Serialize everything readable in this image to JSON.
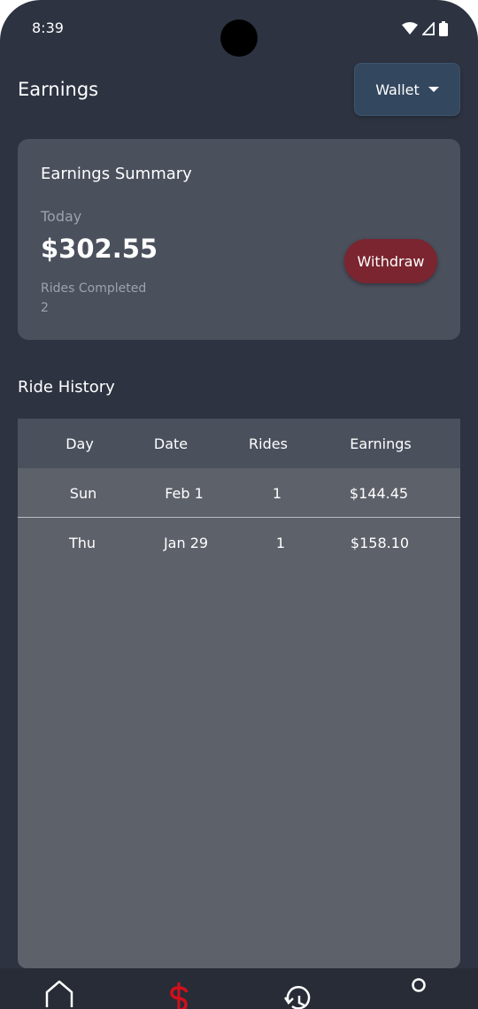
{
  "status_bar": {
    "time": "8:39",
    "icons": [
      "wifi-icon",
      "signal-icon",
      "battery-icon"
    ]
  },
  "header": {
    "title": "Earnings",
    "wallet_dropdown": {
      "label": "Wallet",
      "icon": "caret-down-icon"
    }
  },
  "summary": {
    "title": "Earnings Summary",
    "period_label": "Today",
    "amount": "$302.55",
    "rides_label": "Rides Completed",
    "rides_value": "2",
    "withdraw_label": "Withdraw"
  },
  "history": {
    "title": "Ride History",
    "columns": [
      "Day",
      "Date",
      "Rides",
      "Earnings"
    ],
    "rows": [
      {
        "day": "Sun",
        "date": "Feb 1",
        "rides": "1",
        "earnings": "$144.45"
      },
      {
        "day": "Thu",
        "date": "Jan 29",
        "rides": "1",
        "earnings": "$158.10"
      }
    ]
  },
  "bottom_nav": {
    "items": [
      {
        "icon": "home-icon",
        "active": false
      },
      {
        "icon": "dollar-icon",
        "active": true
      },
      {
        "icon": "history-icon",
        "active": false
      },
      {
        "icon": "profile-icon",
        "active": false
      }
    ]
  },
  "colors": {
    "background": "#2d3341",
    "card": "#4b505d",
    "wallet_button": "#33475e",
    "withdraw_button": "#7a2530",
    "active_nav": "#d0101c",
    "table_body": "#5d616a"
  }
}
